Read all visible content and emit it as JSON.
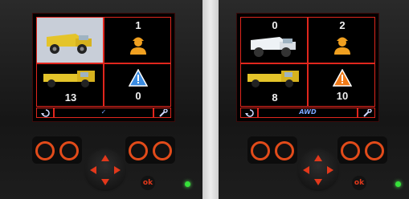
{
  "panels": [
    {
      "trucks_count": "",
      "operators_count": "1",
      "loaders_count": "13",
      "alerts_count": "0",
      "status_text": "✓",
      "selected_cell": "trucks",
      "icon_colors": {
        "truck": "#e4c42a",
        "operator": "#f0a020",
        "alert_fill": "#3a8be0"
      }
    },
    {
      "trucks_count": "0",
      "operators_count": "2",
      "loaders_count": "8",
      "alerts_count": "10",
      "status_text": "AWD",
      "selected_cell": "",
      "icon_colors": {
        "truck": "#eef2f6",
        "operator": "#f0a020",
        "alert_fill": "#f07a18"
      }
    }
  ],
  "buttons": {
    "ok_label": "ok"
  },
  "colors": {
    "frame": "#e0261d",
    "button_ring": "#e24b1a",
    "led": "#36e23a"
  }
}
